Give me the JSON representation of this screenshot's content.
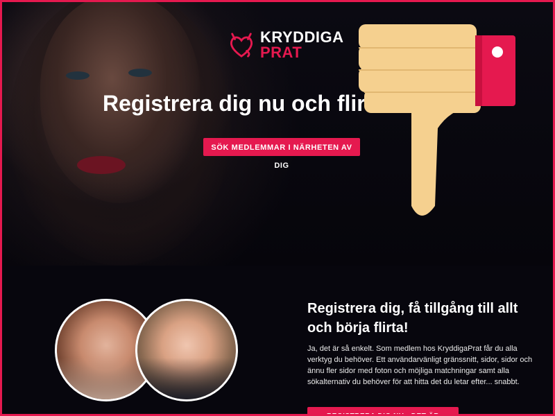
{
  "brand": {
    "line1": "KRYDDIGA",
    "line2": "PRAT",
    "accent": "#e5194f"
  },
  "hero": {
    "headline": "Registrera dig nu och flirta",
    "cta_label": "SÖK MEDLEMMAR I NÄRHETEN AV DIG"
  },
  "overlay": {
    "icon": "thumbs-down-icon"
  },
  "section": {
    "title": "Registrera dig, få tillgång till allt och börja flirta!",
    "body": "Ja, det är så enkelt. Som medlem hos KryddigaPrat får du alla verktyg du behöver. Ett användarvänligt gränssnitt, sidor, sidor och ännu fler sidor med foton och möjliga matchningar samt alla sökalternativ du behöver för att hitta det du letar efter... snabbt.",
    "cta_label": "REGISTRERA DIG NU - DET ÄR GRATIS!"
  },
  "avatars": [
    {
      "icon": "avatar"
    },
    {
      "icon": "avatar"
    }
  ]
}
